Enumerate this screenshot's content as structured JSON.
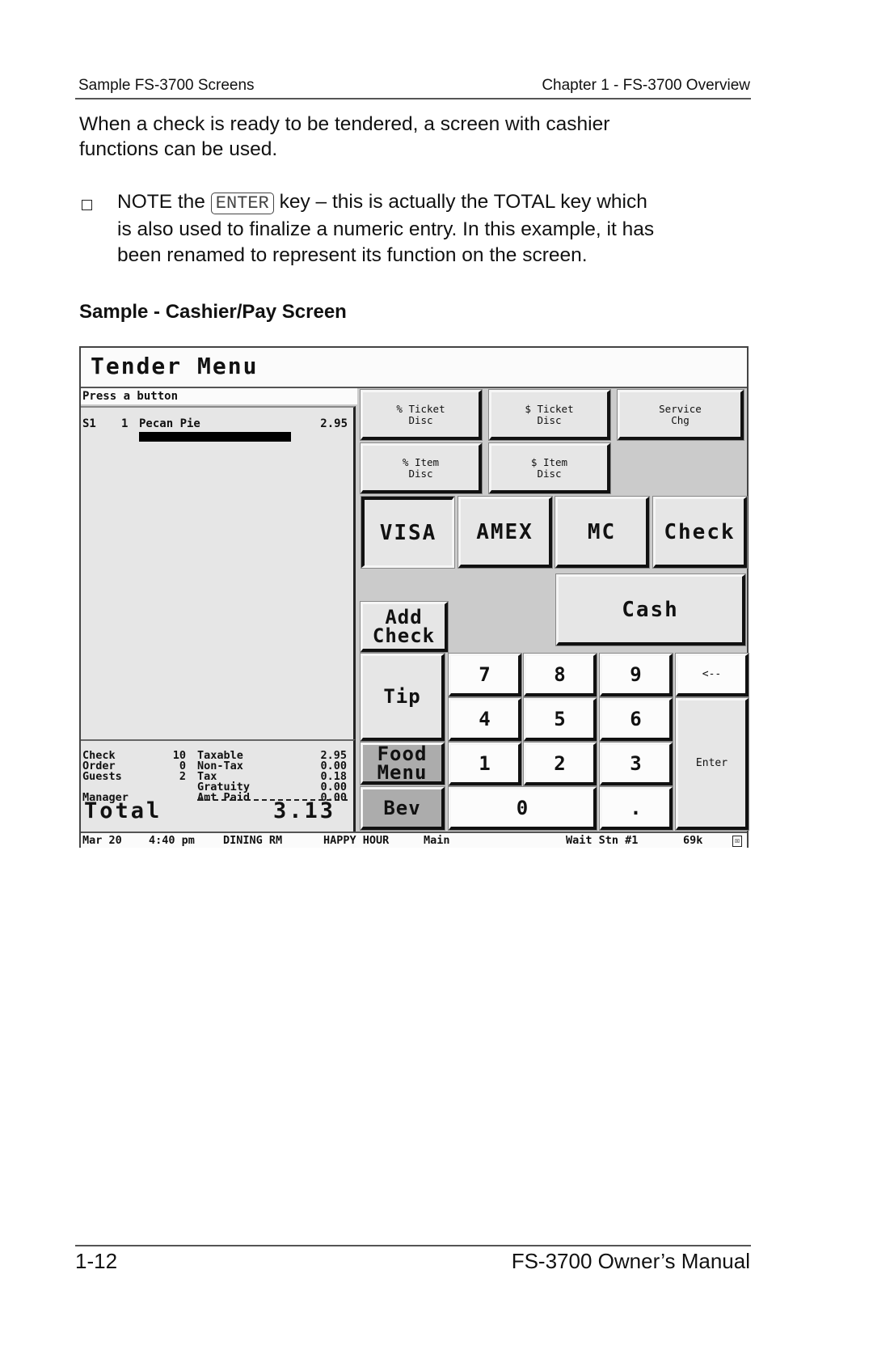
{
  "page_header": {
    "left": "Sample FS-3700 Screens",
    "right": "Chapter 1 - FS-3700 Overview"
  },
  "intro": {
    "line1": "When a check is ready to be tendered, a screen with cashier",
    "line2": "functions can be used."
  },
  "note": {
    "prefix": "NOTE the",
    "key": "ENTER",
    "line1_rest": "key – this is actually the TOTAL key which",
    "line2": "is also used to finalize a numeric entry.  In this example, it has",
    "line3": "been renamed to represent its function on the screen."
  },
  "section_title": "Sample - Cashier/Pay Screen",
  "pos_screen": {
    "title": "Tender Menu",
    "prompt": "Press a button",
    "items": [
      {
        "seat": "S1",
        "qty": "1",
        "name": "Pecan Pie",
        "price": "2.95"
      }
    ],
    "summary": {
      "left": [
        {
          "label": "Check",
          "value": "10"
        },
        {
          "label": "Order",
          "value": "0"
        },
        {
          "label": "Guests",
          "value": "2"
        },
        {
          "label": "Manager",
          "value": ""
        }
      ],
      "right": [
        {
          "label": "Taxable",
          "value": "2.95"
        },
        {
          "label": "Non-Tax",
          "value": "0.00"
        },
        {
          "label": "Tax",
          "value": "0.18"
        },
        {
          "label": "Gratuity",
          "value": "0.00"
        },
        {
          "label": "Amt Paid",
          "value": "0.00"
        }
      ],
      "total_label": "Total",
      "total_value": "3.13"
    },
    "discount_buttons": [
      {
        "line1": "% Ticket",
        "line2": "Disc"
      },
      {
        "line1": "$ Ticket",
        "line2": "Disc"
      },
      {
        "line1": "Service",
        "line2": "Chg"
      },
      {
        "line1": "% Item",
        "line2": "Disc"
      },
      {
        "line1": "$ Item",
        "line2": "Disc"
      }
    ],
    "tender_buttons": [
      "VISA",
      "AMEX",
      "MC",
      "Check"
    ],
    "cash_button": "Cash",
    "side_buttons": {
      "add_check_1": "Add",
      "add_check_2": "Check",
      "tip": "Tip",
      "food_menu_1": "Food",
      "food_menu_2": "Menu",
      "bev": "Bev"
    },
    "keypad": {
      "k7": "7",
      "k8": "8",
      "k9": "9",
      "back": "<--",
      "k4": "4",
      "k5": "5",
      "k6": "6",
      "k1": "1",
      "k2": "2",
      "k3": "3",
      "enter": "Enter",
      "k0": "0",
      "dot": "."
    },
    "status_bar": {
      "date": "Mar 20",
      "time": "4:40 pm",
      "area": "DINING RM",
      "period": "HAPPY HOUR",
      "menu": "Main",
      "station": "Wait Stn #1",
      "memory": "69k",
      "close_icon": "☒"
    }
  },
  "page_footer": {
    "left": "1-12",
    "right": "FS-3700 Owner’s Manual"
  }
}
